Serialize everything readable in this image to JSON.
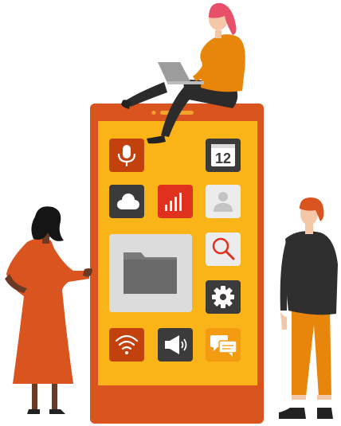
{
  "scene": "illustration",
  "colors": {
    "phone_body": "#d9541e",
    "phone_screen": "#fbb417",
    "icon_red": "#c2410c",
    "icon_dark": "#3b3b3b",
    "icon_light": "#ececec",
    "icon_orange": "#f39c12",
    "accent_red": "#e0301e",
    "hair_pink": "#e8506a",
    "shirt_orange": "#e8860c"
  },
  "apps": [
    {
      "name": "microphone-app",
      "icon": "microphone-icon"
    },
    {
      "name": "calendar-app",
      "icon": "calendar-icon",
      "label": "12"
    },
    {
      "name": "cloud-app",
      "icon": "cloud-icon"
    },
    {
      "name": "signal-bars-app",
      "icon": "bar-chart-icon"
    },
    {
      "name": "contacts-app",
      "icon": "person-icon"
    },
    {
      "name": "folder-app",
      "icon": "folder-icon"
    },
    {
      "name": "search-app",
      "icon": "magnifier-icon"
    },
    {
      "name": "settings-app",
      "icon": "gear-icon"
    },
    {
      "name": "wifi-app",
      "icon": "wifi-icon"
    },
    {
      "name": "announcement-app",
      "icon": "megaphone-icon"
    },
    {
      "name": "messages-app",
      "icon": "chat-bubbles-icon"
    }
  ]
}
